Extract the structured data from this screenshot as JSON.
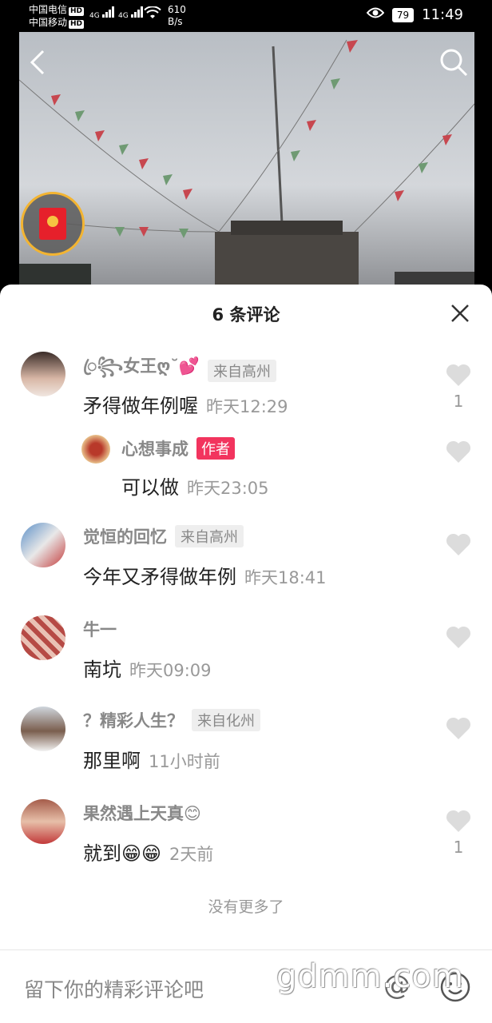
{
  "status_bar": {
    "carrier1": "中国电信",
    "carrier2": "中国移动",
    "hd": "HD",
    "net1": "4G",
    "net2": "4G",
    "speed_value": "610",
    "speed_unit": "B/s",
    "battery": "79",
    "time": "11:49"
  },
  "sheet": {
    "title": "6 条评论"
  },
  "comments": [
    {
      "name": "ꦿ꧂女王ღ˘💕",
      "tag": "来自高州",
      "text": "矛得做年例喔",
      "time": "昨天12:29",
      "likes": "1",
      "reply": {
        "name": "心想事成",
        "author_badge": "作者",
        "text": "可以做",
        "time": "昨天23:05"
      }
    },
    {
      "name": "觉恒的回忆",
      "tag": "来自高州",
      "text": "今年又矛得做年例",
      "time": "昨天18:41",
      "likes": ""
    },
    {
      "name": "牛一",
      "tag": "",
      "text": "南坑",
      "time": "昨天09:09",
      "likes": ""
    },
    {
      "name": "？精彩人生？",
      "tag": "来自化州",
      "text": "那里啊",
      "time": "11小时前",
      "likes": ""
    },
    {
      "name": "果然遇上天真😊",
      "tag": "",
      "text": "就到😁😁",
      "time": "2天前",
      "likes": "1"
    }
  ],
  "no_more": "没有更多了",
  "input": {
    "placeholder": "留下你的精彩评论吧",
    "at_symbol": "@"
  },
  "watermark": "gdmm.com",
  "colors": {
    "author_badge": "#f2345e",
    "redpacket_ring": "#f3b431",
    "redpacket": "#e6202b"
  }
}
